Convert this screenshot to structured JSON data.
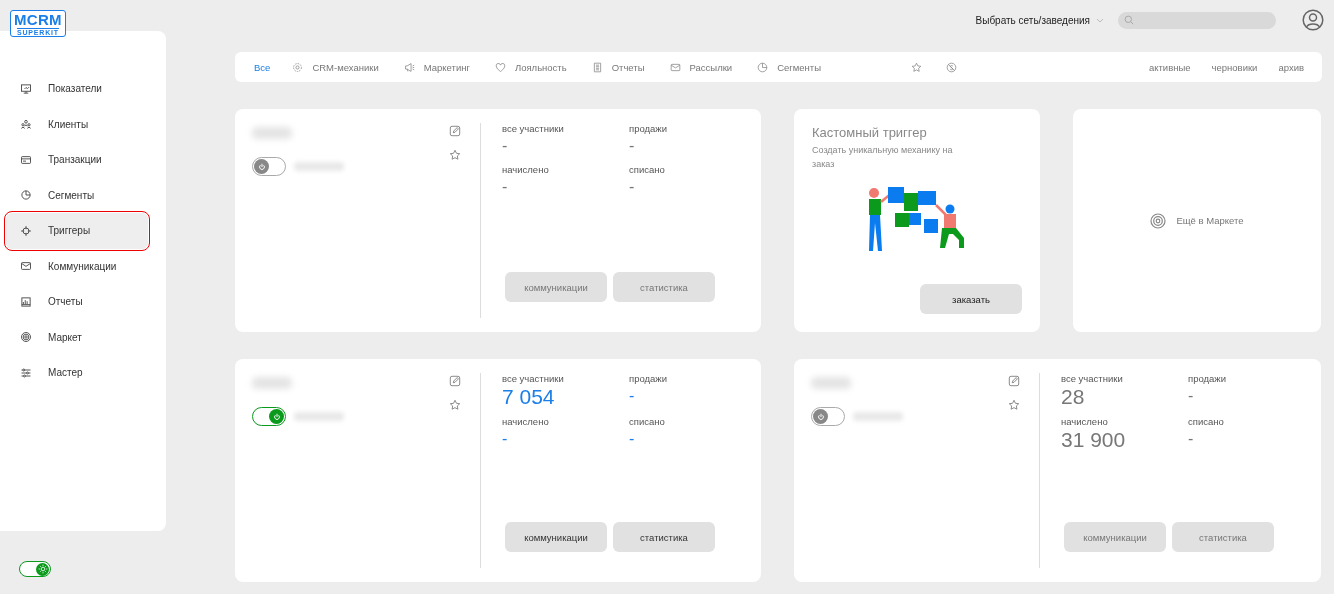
{
  "logo": {
    "main": "MCRM",
    "sub": "SUPERKIT"
  },
  "sidebar": {
    "items": [
      {
        "label": "Показатели",
        "selected": false
      },
      {
        "label": "Клиенты",
        "selected": false
      },
      {
        "label": "Транзакции",
        "selected": false
      },
      {
        "label": "Сегменты",
        "selected": false
      },
      {
        "label": "Триггеры",
        "selected": true
      },
      {
        "label": "Коммуникации",
        "selected": false
      },
      {
        "label": "Отчеты",
        "selected": false
      },
      {
        "label": "Маркет",
        "selected": false
      },
      {
        "label": "Мастер",
        "selected": false
      }
    ],
    "theme_toggle": {
      "on": true
    }
  },
  "header": {
    "venue_select": "Выбрать сеть/заведения"
  },
  "filters": {
    "categories": [
      {
        "label": "Все",
        "selected": true
      },
      {
        "label": "CRM-механики",
        "selected": false
      },
      {
        "label": "Маркетинг",
        "selected": false
      },
      {
        "label": "Лояльность",
        "selected": false
      },
      {
        "label": "Отчеты",
        "selected": false
      },
      {
        "label": "Рассылки",
        "selected": false
      },
      {
        "label": "Сегменты",
        "selected": false
      }
    ],
    "statuses": [
      "активные",
      "черновики",
      "архив"
    ]
  },
  "cards": [
    {
      "kind": "trigger",
      "active": false,
      "stats": [
        {
          "label": "все участники",
          "value": "-"
        },
        {
          "label": "продажи",
          "value": "-"
        },
        {
          "label": "начислено",
          "value": "-"
        },
        {
          "label": "списано",
          "value": "-"
        }
      ],
      "buttons": [
        "коммуникации",
        "статистика"
      ]
    },
    {
      "kind": "custom",
      "title": "Кастомный триггер",
      "description": "Создать уникальную механику на заказ",
      "button": "заказать"
    },
    {
      "kind": "market",
      "label": "Ещё в Маркете"
    },
    {
      "kind": "trigger",
      "active": true,
      "stats": [
        {
          "label": "все участники",
          "value": "7 054"
        },
        {
          "label": "продажи",
          "value": "-"
        },
        {
          "label": "начислено",
          "value": "-"
        },
        {
          "label": "списано",
          "value": "-"
        }
      ],
      "buttons": [
        "коммуникации",
        "статистика"
      ]
    },
    {
      "kind": "trigger",
      "active": false,
      "stats": [
        {
          "label": "все участники",
          "value": "28"
        },
        {
          "label": "продажи",
          "value": "-"
        },
        {
          "label": "начислено",
          "value": "31 900"
        },
        {
          "label": "списано",
          "value": "-"
        }
      ],
      "buttons": [
        "коммуникации",
        "статистика"
      ]
    }
  ]
}
